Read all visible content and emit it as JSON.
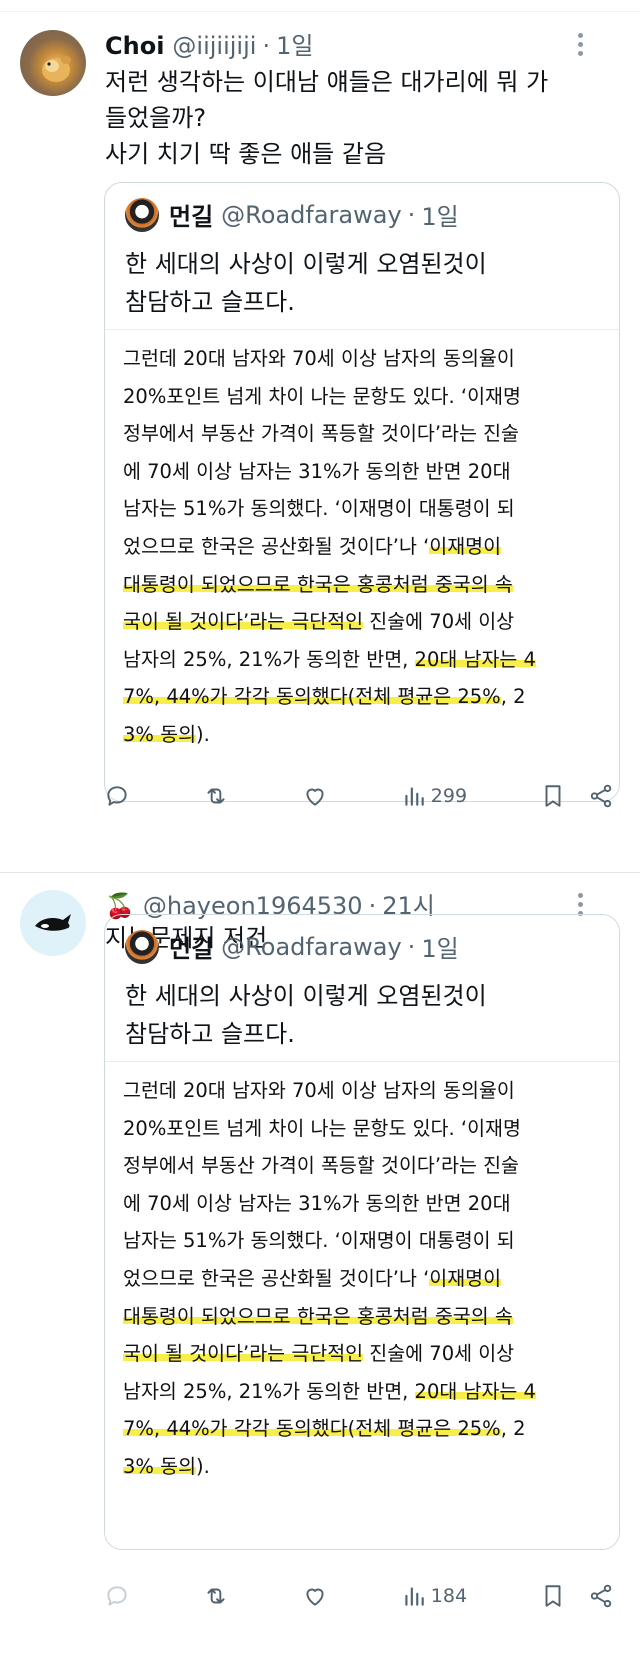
{
  "tweets": [
    {
      "display_name": "Choi",
      "handle": "@iijiijiji",
      "time": "1일",
      "text": [
        "저런 생각하는 이대남 얘들은 대가리에 뭐 가",
        "들었을까?",
        "사기 치기 딱 좋은 애들 같음"
      ],
      "quote": {
        "display_name": "먼길",
        "handle": "@Roadfaraway",
        "time": "1일",
        "text": [
          "한 세대의 사상이 이렇게 오염된것이",
          "참담하고 슬프다."
        ]
      },
      "views": "299"
    },
    {
      "display_name": "🍒",
      "handle": "@hayeon1964530",
      "time": "21시",
      "text": [
        "지능문제지 저건"
      ],
      "quote": {
        "display_name": "먼길",
        "handle": "@Roadfaraway",
        "time": "1일",
        "text": [
          "한 세대의 사상이 이렇게 오염된것이",
          "참담하고 슬프다."
        ]
      },
      "views": "184"
    }
  ],
  "article": {
    "lines": [
      {
        "pre": "그런데 20대 남자와 70세 이상 남자의 동의율이",
        "hl": "",
        "post": ""
      },
      {
        "pre": "20%포인트 넘게 차이 나는 문항도 있다. ‘이재명",
        "hl": "",
        "post": ""
      },
      {
        "pre": "정부에서 부동산 가격이 폭등할 것이다’라는 진술",
        "hl": "",
        "post": ""
      },
      {
        "pre": "에 70세 이상 남자는 31%가 동의한 반면 20대",
        "hl": "",
        "post": ""
      },
      {
        "pre": "남자는 51%가 동의했다. ‘이재명이 대통령이 되",
        "hl": "",
        "post": ""
      },
      {
        "pre": "었으므로 한국은 공산화될 것이다’나 ‘",
        "hl": "이재명이",
        "post": ""
      },
      {
        "pre": "",
        "hl": "대통령이 되었으므로 한국은 홍콩처럼 중국의 속",
        "post": ""
      },
      {
        "pre": "",
        "hl": "국이 될 것이다’라는 극단적인",
        "post": " 진술에 70세 이상"
      },
      {
        "pre": "남자의 25%, 21%가 동의한 반면, ",
        "hl": "20대 남자는 4",
        "post": ""
      },
      {
        "pre": "",
        "hl": "7%, 44%가 각각 동의했다(전체 평균은 25%",
        "post": ", 2"
      },
      {
        "pre": "",
        "hl": "3% 동의",
        "post": ")."
      }
    ]
  },
  "icons": {
    "reply": "reply-icon",
    "retweet": "retweet-icon",
    "like": "heart-icon",
    "views": "views-icon",
    "bookmark": "bookmark-icon",
    "share": "share-icon",
    "more": "more-icon"
  },
  "colors": {
    "highlight": "#f7ee4a",
    "muted": "#536471",
    "border": "#cfd9de"
  }
}
